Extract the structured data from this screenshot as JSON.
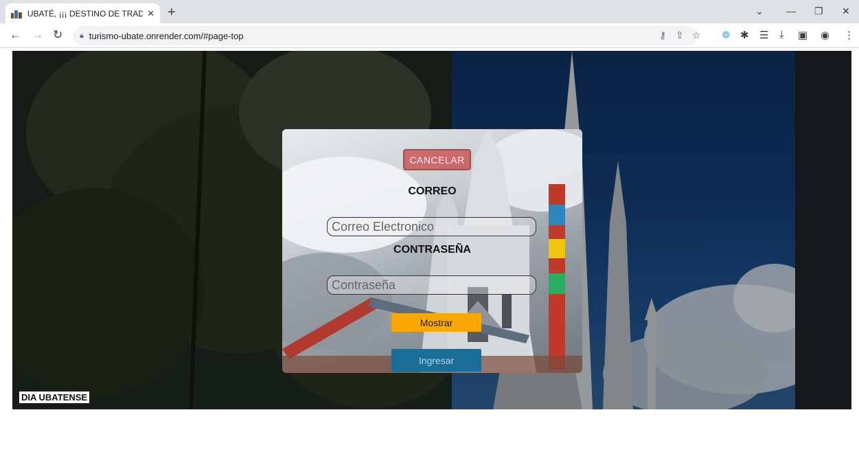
{
  "browser": {
    "tab_title": "UBATÉ, ¡¡¡ DESTINO DE TRADICIO",
    "tab_close": "✕",
    "new_tab": "+",
    "url": "turismo-ubate.onrender.com/#page-top"
  },
  "hero": {
    "caption": "DIA UBATENSE"
  },
  "login_modal": {
    "cancel_label": "CANCELAR",
    "email_label": "CORREO",
    "email_placeholder": "Correo Electronico",
    "password_label": "CONTRASEÑA",
    "password_placeholder": "Contraseña",
    "show_label": "Mostrar",
    "submit_label": "Ingresar"
  },
  "colors": {
    "cancel": "#c45050",
    "show": "#f9a805",
    "submit": "#1a6d95"
  },
  "icons": [
    "back-icon",
    "forward-icon",
    "reload-icon",
    "lock-icon",
    "key-icon",
    "share-icon",
    "star-icon",
    "extension-icon",
    "puzzle-icon",
    "reading-list-icon",
    "download-icon",
    "sidepanel-icon",
    "profile-icon",
    "menu-icon"
  ]
}
